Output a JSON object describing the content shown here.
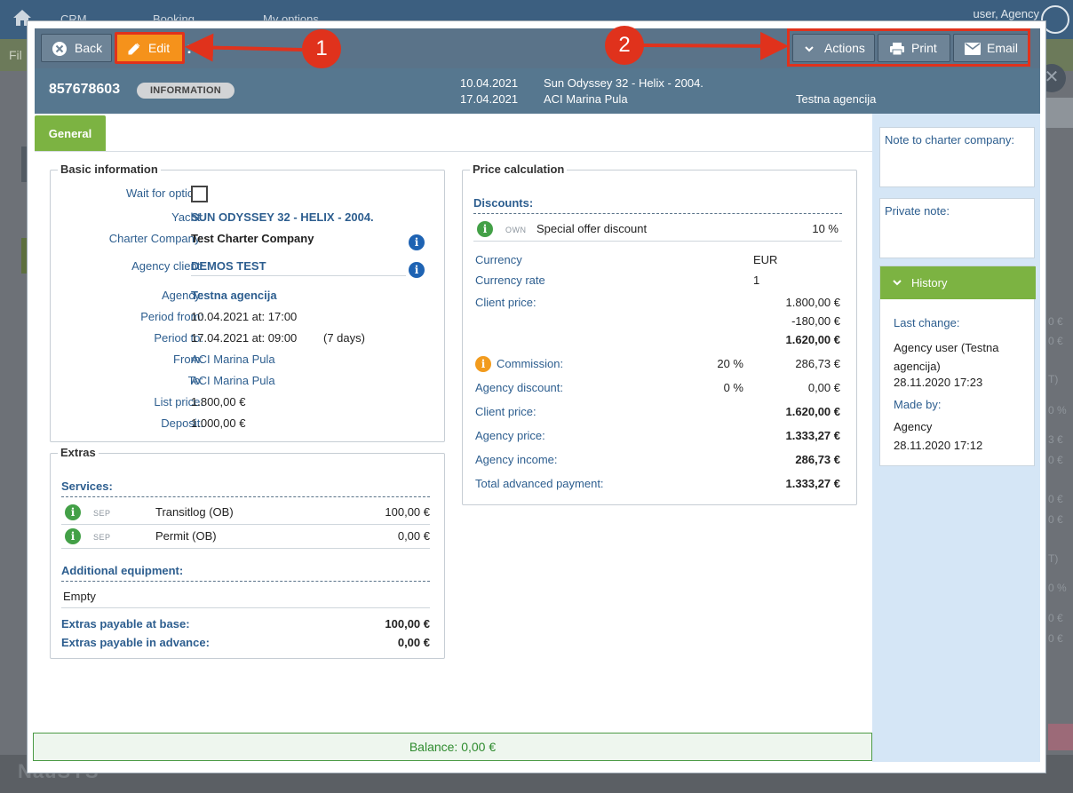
{
  "background": {
    "nav": [
      "CRM",
      "Booking",
      "My options"
    ],
    "user_label": "user, Agency",
    "filter_label": "Fil",
    "brand": "NauSYS",
    "side_numbers": [
      "0 €",
      "0 €",
      "T)",
      "0 %",
      "3 €",
      "0 €",
      "0 €",
      "0 €",
      "T)",
      "0 %",
      "0 €",
      "0 €"
    ]
  },
  "toolbar": {
    "back_label": "Back",
    "edit_label": "Edit",
    "colon": ":",
    "actions_label": "Actions",
    "print_label": "Print",
    "email_label": "Email"
  },
  "annotations": {
    "one": "1",
    "two": "2",
    "color": "#e0321c"
  },
  "header": {
    "booking_id": "857678603",
    "badge": "INFORMATION",
    "date_from": "10.04.2021",
    "date_to": "17.04.2021",
    "yacht": "Sun Odyssey 32 - Helix - 2004.",
    "base": "ACI Marina Pula",
    "agency": "Testna agencija"
  },
  "tabs": [
    "General"
  ],
  "basic_info": {
    "legend": "Basic information",
    "rows": [
      {
        "label": "Wait for option:",
        "value": ""
      },
      {
        "label": "Yacht:",
        "value": "SUN ODYSSEY 32 - HELIX - 2004."
      },
      {
        "label": "Charter Company:",
        "value": "Test Charter Company"
      },
      {
        "label": "Agency client:",
        "value": "DEMOS TEST"
      },
      {
        "label": "Agency:",
        "value": "Testna agencija"
      },
      {
        "label": "Period from:",
        "value": "10.04.2021 at: 17:00"
      },
      {
        "label": "Period to:",
        "value": "17.04.2021 at: 09:00"
      },
      {
        "label": "From:",
        "value": "ACI Marina Pula"
      },
      {
        "label": "To:",
        "value": "ACI Marina Pula"
      },
      {
        "label": "List price:",
        "value": "1.800,00 €"
      },
      {
        "label": "Deposit:",
        "value": "1.000,00 €"
      }
    ],
    "days": "(7 days)"
  },
  "extras": {
    "legend": "Extras",
    "services_title": "Services:",
    "services": [
      {
        "tag": "SEP",
        "name": "Transitlog (OB)",
        "price": "100,00 €"
      },
      {
        "tag": "SEP",
        "name": "Permit (OB)",
        "price": "0,00 €"
      }
    ],
    "equipment_title": "Additional equipment:",
    "equipment_empty": "Empty",
    "payable_base_label": "Extras payable at base:",
    "payable_base_value": "100,00 €",
    "payable_advance_label": "Extras payable in advance:",
    "payable_advance_value": "0,00 €"
  },
  "price_calc": {
    "legend": "Price calculation",
    "discounts_title": "Discounts:",
    "discount": {
      "tag": "OWN",
      "name": "Special offer discount",
      "value": "10 %"
    },
    "currency_label": "Currency",
    "currency_value": "EUR",
    "rate_label": "Currency rate",
    "rate_value": "1",
    "client_price_label": "Client price:",
    "client_price_lines": [
      "1.800,00 €",
      "-180,00 €",
      "1.620,00 €"
    ],
    "commission_label": "Commission:",
    "commission_pct": "20 %",
    "commission_value": "286,73 €",
    "agency_discount_label": "Agency discount:",
    "agency_discount_pct": "0 %",
    "agency_discount_value": "0,00 €",
    "client_price2_label": "Client price:",
    "client_price2_value": "1.620,00 €",
    "agency_price_label": "Agency price:",
    "agency_price_value": "1.333,27 €",
    "agency_income_label": "Agency income:",
    "agency_income_value": "286,73 €",
    "advance_label": "Total advanced payment:",
    "advance_value": "1.333,27 €"
  },
  "sidebar": {
    "note_label": "Note to charter company:",
    "private_label": "Private note:",
    "history_title": "History",
    "last_change_label": "Last change:",
    "last_change_user": "Agency user (Testna agencija)",
    "last_change_date": "28.11.2020 17:23",
    "made_by_label": "Made by:",
    "made_by_user": "Agency",
    "made_by_date": "28.11.2020 17:12"
  },
  "balance": "Balance: 0,00 €"
}
